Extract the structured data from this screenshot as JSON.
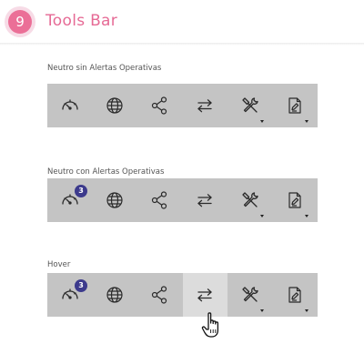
{
  "header": {
    "step_number": "9",
    "title": "Tools Bar"
  },
  "sections": [
    {
      "label": "Neutro sin Alertas Operativas",
      "badge": null,
      "hover_index": null
    },
    {
      "label": "Neutro con Alertas Operativas",
      "badge": "3",
      "hover_index": null
    },
    {
      "label": "Hover",
      "badge": "3",
      "hover_index": 3
    }
  ],
  "tools": [
    {
      "icon": "speedometer-icon",
      "has_dropdown": false
    },
    {
      "icon": "globe-icon",
      "has_dropdown": false
    },
    {
      "icon": "share-icon",
      "has_dropdown": false
    },
    {
      "icon": "transfer-arrows-icon",
      "has_dropdown": false
    },
    {
      "icon": "tools-icon",
      "has_dropdown": true
    },
    {
      "icon": "document-edit-icon",
      "has_dropdown": true
    }
  ],
  "colors": {
    "accent": "#e66a95",
    "toolbar_bg": "#c4c4c4",
    "hover_bg": "#dcdcdc",
    "badge_bg": "#3c3a8c"
  }
}
